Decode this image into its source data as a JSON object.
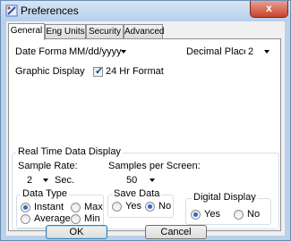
{
  "window": {
    "title": "Preferences",
    "close_glyph": "x"
  },
  "tabs": [
    {
      "label": "General",
      "active": true
    },
    {
      "label": "Eng Units",
      "active": false
    },
    {
      "label": "Security",
      "active": false
    },
    {
      "label": "Advanced",
      "active": false
    }
  ],
  "general": {
    "date_format_label": "Date Format",
    "date_format_value": "MM/dd/yyyy",
    "decimal_places_label": "Decimal Places",
    "decimal_places_value": "2",
    "graphic_display_label": "Graphic Display",
    "hr24_checked": true,
    "hr24_label": "24 Hr Format"
  },
  "realtime": {
    "title": "Real Time Data Display",
    "sample_rate_label": "Sample Rate:",
    "sample_rate_value": "2",
    "sample_rate_unit": "Sec.",
    "samples_per_screen_label": "Samples per Screen:",
    "samples_per_screen_value": "50",
    "data_type": {
      "title": "Data Type",
      "instant": "Instant",
      "max": "Max",
      "average": "Average",
      "min": "Min",
      "selected": "Instant"
    },
    "save_data": {
      "title": "Save Data",
      "yes": "Yes",
      "no": "No",
      "selected": "No"
    },
    "digital_display": {
      "title": "Digital Display",
      "yes": "Yes",
      "no": "No",
      "selected": "Yes"
    }
  },
  "buttons": {
    "ok": "OK",
    "cancel": "Cancel"
  },
  "colors": {
    "frame": "#b9d1ea",
    "close": "#c7432c",
    "radio_dot": "#2a6bc7"
  }
}
